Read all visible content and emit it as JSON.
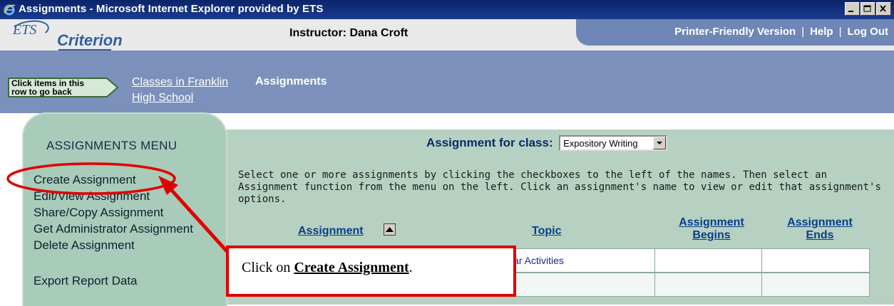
{
  "window": {
    "title": "Assignments - Microsoft Internet Explorer provided by ETS",
    "icons": [
      "ie-icon",
      "minimize-icon",
      "maximize-icon",
      "close-icon"
    ]
  },
  "header": {
    "logo_ets": "ETS",
    "logo_criterion": "Criterion",
    "instructor": "Instructor: Dana Croft",
    "nav": {
      "printer": "Printer-Friendly Version",
      "help": "Help",
      "logout": "Log Out",
      "separator": "|"
    }
  },
  "breadcrumb": {
    "hint": "Click items in this row to go back",
    "hint_line1": "Click items in this",
    "hint_line2": "row to go back",
    "crumb_classes": "Classes in Franklin High School",
    "crumb_current": "Assignments"
  },
  "sidebar": {
    "heading": "ASSIGNMENTS MENU",
    "items": [
      {
        "label": "Create Assignment"
      },
      {
        "label": "Edit/View Assignment"
      },
      {
        "label": "Share/Copy Assignment"
      },
      {
        "label": "Get Administrator Assignment"
      },
      {
        "label": "Delete Assignment"
      },
      {
        "label": "Export Report Data"
      }
    ]
  },
  "main": {
    "class_label": "Assignment for class:",
    "class_selected": "Expository Writing",
    "instructions": "Select one or more assignments by clicking the checkboxes to the left of the names. Then select an Assignment function from the menu on the left. Click an assignment's name to view or edit that assignment's options.",
    "columns": {
      "assignment": "Assignment",
      "topic": "Topic",
      "begins": "Assignment Begins",
      "begins_l1": "Assignment",
      "begins_l2": "Begins",
      "ends": "Assignment Ends",
      "ends_l1": "Assignment",
      "ends_l2": "Ends"
    },
    "row_topic_fragment": "lar Activities"
  },
  "callout": {
    "prefix": "Click on ",
    "emph": "Create Assignment",
    "suffix": "."
  },
  "colors": {
    "title_bar": "#0a246a",
    "header_bg": "#e9e9e9",
    "nav_bg": "#6f87b7",
    "crumb_bg": "#7b91bb",
    "sidebar_bg": "#a9cbb9",
    "main_bg": "#b6d1c1",
    "annotation_red": "#e00000",
    "link_blue": "#0b3d8a"
  }
}
